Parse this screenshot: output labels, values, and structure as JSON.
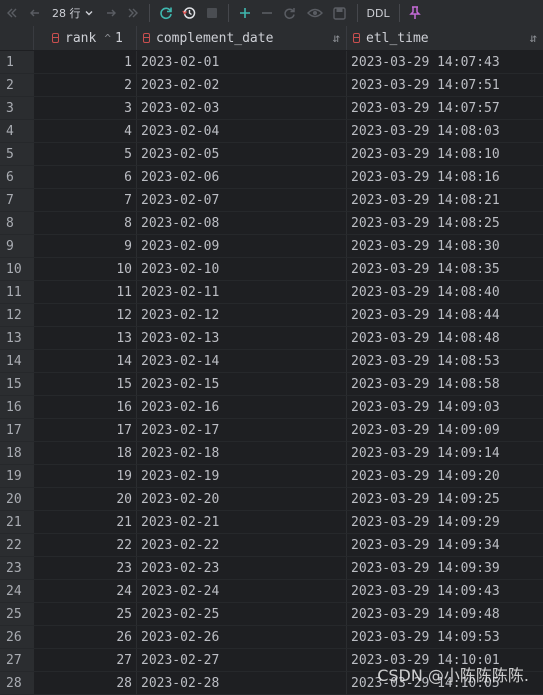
{
  "toolbar": {
    "row_count_label": "28 行",
    "ddl_label": "DDL"
  },
  "columns": [
    {
      "label": "rank",
      "sort_order": "1"
    },
    {
      "label": "complement_date"
    },
    {
      "label": "etl_time"
    }
  ],
  "rows": [
    [
      "1",
      "1",
      "2023-02-01",
      "2023-03-29 14:07:43"
    ],
    [
      "2",
      "2",
      "2023-02-02",
      "2023-03-29 14:07:51"
    ],
    [
      "3",
      "3",
      "2023-02-03",
      "2023-03-29 14:07:57"
    ],
    [
      "4",
      "4",
      "2023-02-04",
      "2023-03-29 14:08:03"
    ],
    [
      "5",
      "5",
      "2023-02-05",
      "2023-03-29 14:08:10"
    ],
    [
      "6",
      "6",
      "2023-02-06",
      "2023-03-29 14:08:16"
    ],
    [
      "7",
      "7",
      "2023-02-07",
      "2023-03-29 14:08:21"
    ],
    [
      "8",
      "8",
      "2023-02-08",
      "2023-03-29 14:08:25"
    ],
    [
      "9",
      "9",
      "2023-02-09",
      "2023-03-29 14:08:30"
    ],
    [
      "10",
      "10",
      "2023-02-10",
      "2023-03-29 14:08:35"
    ],
    [
      "11",
      "11",
      "2023-02-11",
      "2023-03-29 14:08:40"
    ],
    [
      "12",
      "12",
      "2023-02-12",
      "2023-03-29 14:08:44"
    ],
    [
      "13",
      "13",
      "2023-02-13",
      "2023-03-29 14:08:48"
    ],
    [
      "14",
      "14",
      "2023-02-14",
      "2023-03-29 14:08:53"
    ],
    [
      "15",
      "15",
      "2023-02-15",
      "2023-03-29 14:08:58"
    ],
    [
      "16",
      "16",
      "2023-02-16",
      "2023-03-29 14:09:03"
    ],
    [
      "17",
      "17",
      "2023-02-17",
      "2023-03-29 14:09:09"
    ],
    [
      "18",
      "18",
      "2023-02-18",
      "2023-03-29 14:09:14"
    ],
    [
      "19",
      "19",
      "2023-02-19",
      "2023-03-29 14:09:20"
    ],
    [
      "20",
      "20",
      "2023-02-20",
      "2023-03-29 14:09:25"
    ],
    [
      "21",
      "21",
      "2023-02-21",
      "2023-03-29 14:09:29"
    ],
    [
      "22",
      "22",
      "2023-02-22",
      "2023-03-29 14:09:34"
    ],
    [
      "23",
      "23",
      "2023-02-23",
      "2023-03-29 14:09:39"
    ],
    [
      "24",
      "24",
      "2023-02-24",
      "2023-03-29 14:09:43"
    ],
    [
      "25",
      "25",
      "2023-02-25",
      "2023-03-29 14:09:48"
    ],
    [
      "26",
      "26",
      "2023-02-26",
      "2023-03-29 14:09:53"
    ],
    [
      "27",
      "27",
      "2023-02-27",
      "2023-03-29 14:10:01"
    ],
    [
      "28",
      "28",
      "2023-02-28",
      "2023-03-29 14:10:05"
    ]
  ],
  "watermark": "CSDN @小陈陈陈陈.",
  "colors": {
    "background": "#2b2d30",
    "grid_background": "#1e1f22",
    "refresh_icon": "#3fb8af",
    "add_icon": "#3fb8af",
    "pin_icon": "#c46bd6",
    "column_icon": "#c94f4f"
  },
  "icons": [
    "first-page-icon",
    "prev-page-icon",
    "next-page-icon",
    "last-page-icon",
    "refresh-icon",
    "history-icon",
    "stop-icon",
    "add-row-icon",
    "delete-row-icon",
    "revert-icon",
    "view-icon",
    "save-icon",
    "pin-icon"
  ]
}
